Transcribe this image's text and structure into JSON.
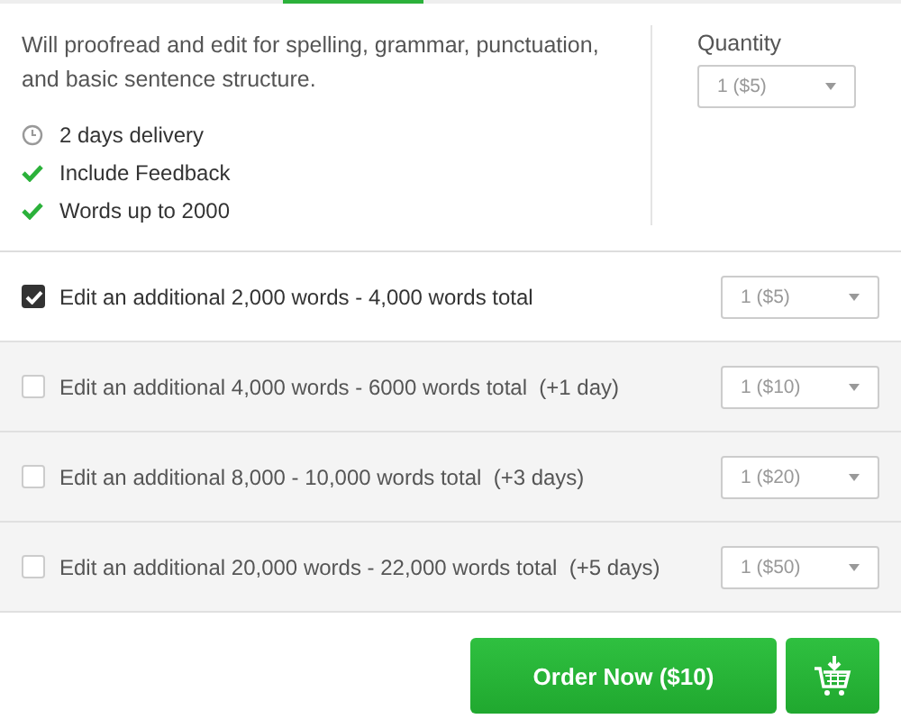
{
  "description": "Will proofread and edit for spelling, grammar, punctuation, and basic sentence structure.",
  "features": [
    {
      "kind": "clock",
      "text": "2 days delivery"
    },
    {
      "kind": "check",
      "text": "Include Feedback"
    },
    {
      "kind": "check",
      "text": "Words up to 2000"
    }
  ],
  "quantity": {
    "label": "Quantity",
    "value": "1 ($5)"
  },
  "extras": [
    {
      "label": "Edit an additional 2,000 words - 4,000 words total",
      "checked": true,
      "quantity": "1 ($5)"
    },
    {
      "label": "Edit an additional 4,000 words - 6000 words total  (+1 day)",
      "checked": false,
      "quantity": "1 ($10)"
    },
    {
      "label": "Edit an additional 8,000 - 10,000 words total  (+3 days)",
      "checked": false,
      "quantity": "1 ($20)"
    },
    {
      "label": "Edit an additional 20,000 words - 22,000 words total  (+5 days)",
      "checked": false,
      "quantity": "1 ($50)"
    }
  ],
  "order_button": "Order Now ($10)"
}
